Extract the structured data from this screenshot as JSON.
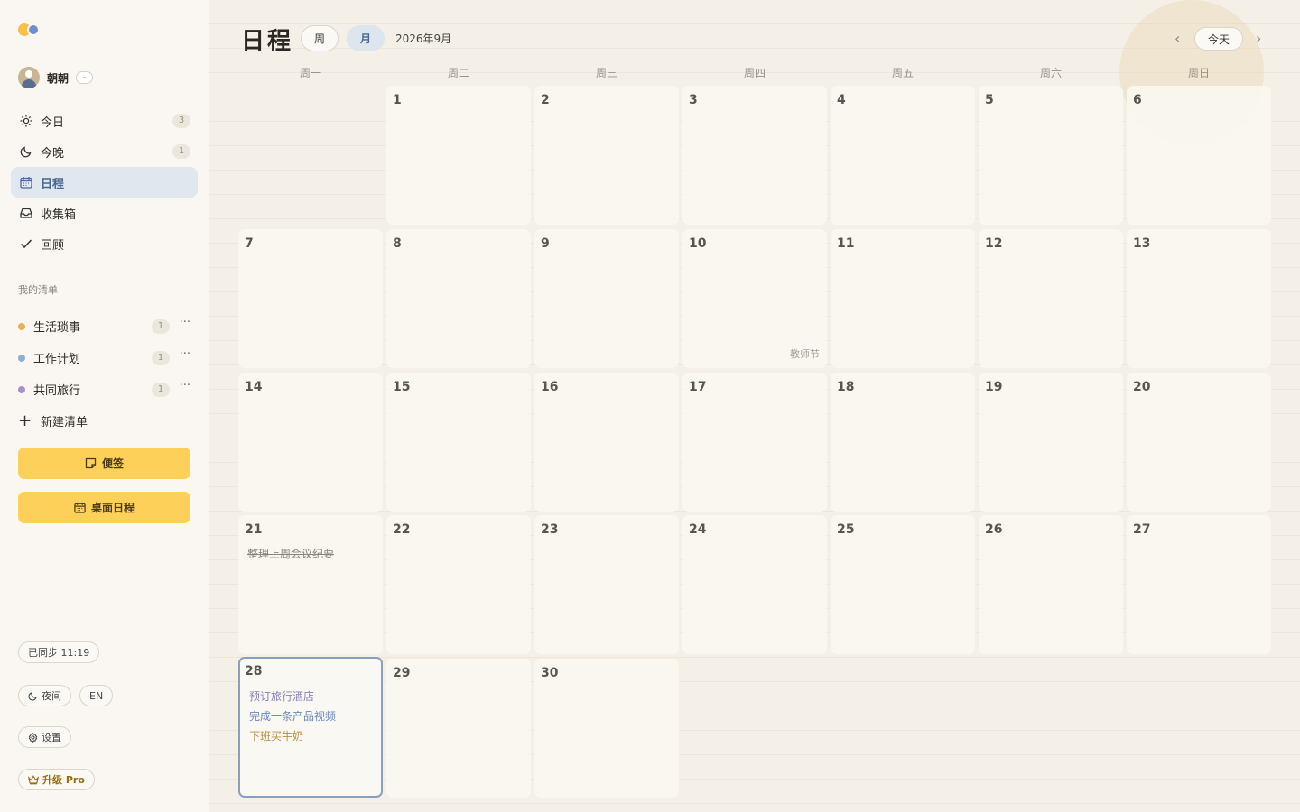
{
  "sidebar": {
    "user": {
      "name": "朝朝",
      "badge": "-"
    },
    "nav": [
      {
        "label": "今日",
        "count": "3",
        "icon": "sun-icon"
      },
      {
        "label": "今晚",
        "count": "1",
        "icon": "moon-icon"
      },
      {
        "label": "日程",
        "count": "",
        "icon": "calendar-icon",
        "active": true
      },
      {
        "label": "收集箱",
        "count": "",
        "icon": "inbox-icon"
      },
      {
        "label": "回顾",
        "count": "",
        "icon": "check-icon"
      }
    ],
    "lists_heading": "我的清单",
    "lists": [
      {
        "label": "生活琐事",
        "count": "1",
        "color": "#e8b05a"
      },
      {
        "label": "工作计划",
        "count": "1",
        "color": "#8ab2d0"
      },
      {
        "label": "共同旅行",
        "count": "1",
        "color": "#a890c8"
      }
    ],
    "more_label": "···",
    "new_list_label": "新建清单",
    "notes_button": "便签",
    "desktop_button": "桌面日程",
    "sync_status": "已同步 11:19",
    "night_mode": "夜间",
    "language": "EN",
    "settings": "设置",
    "upgrade": "升级 Pro"
  },
  "header": {
    "title": "日程",
    "week_tab": "周",
    "month_tab": "月",
    "month_label": "2026年9月",
    "prev": "‹",
    "next": "›",
    "today_button": "今天"
  },
  "weekdays": [
    "周一",
    "周二",
    "周三",
    "周四",
    "周五",
    "周六",
    "周日"
  ],
  "calendar": {
    "days": [
      "1",
      "2",
      "3",
      "4",
      "5",
      "6",
      "7",
      "8",
      "9",
      "10",
      "11",
      "12",
      "13",
      "14",
      "15",
      "16",
      "17",
      "18",
      "19",
      "20",
      "21",
      "22",
      "23",
      "24",
      "25",
      "26",
      "27",
      "28",
      "29",
      "30"
    ],
    "holiday_10": "教师节",
    "tasks_21": [
      "整理上周会议纪要"
    ],
    "tasks_28": [
      "预订旅行酒店",
      "完成一条产品视频",
      "下班买牛奶"
    ]
  }
}
